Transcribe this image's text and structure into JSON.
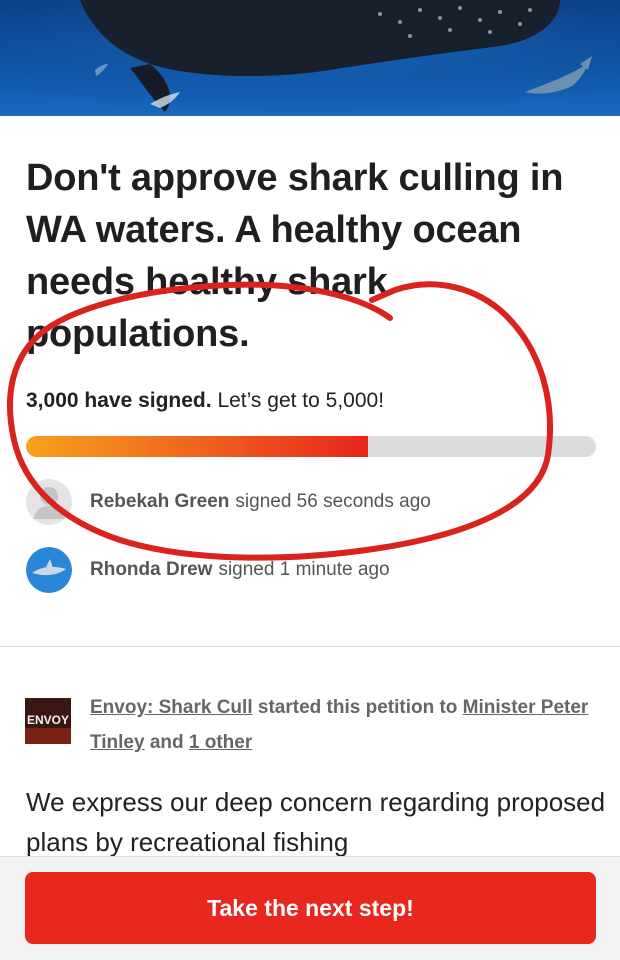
{
  "petition": {
    "title": "Don't approve shark culling in WA waters. A healthy ocean needs healthy shark populations."
  },
  "signatures": {
    "count_text": "3,000 have signed.",
    "goal_text": "Let’s get to 5,000!",
    "progress_fraction": 0.6
  },
  "recent_signers": [
    {
      "name": "Rebekah Green",
      "action": "signed 56 seconds ago",
      "avatar": "default-user-avatar"
    },
    {
      "name": "Rhonda Drew",
      "action": "signed 1 minute ago",
      "avatar": "shark-photo-avatar"
    }
  ],
  "starter": {
    "org_name": "Envoy: Shark Cull",
    "middle_text": "started this petition to",
    "target": "Minister Peter Tinley",
    "and_text": "and",
    "others": "1 other",
    "logo_text": "ENVOY"
  },
  "body": {
    "intro": "We express our deep concern regarding proposed plans by recreational fishing"
  },
  "cta": {
    "label": "Take the next step!"
  },
  "colors": {
    "accent": "#e8271f",
    "progress_start": "#f7a11a",
    "progress_end": "#e8261e",
    "annotation": "#d9231c"
  }
}
